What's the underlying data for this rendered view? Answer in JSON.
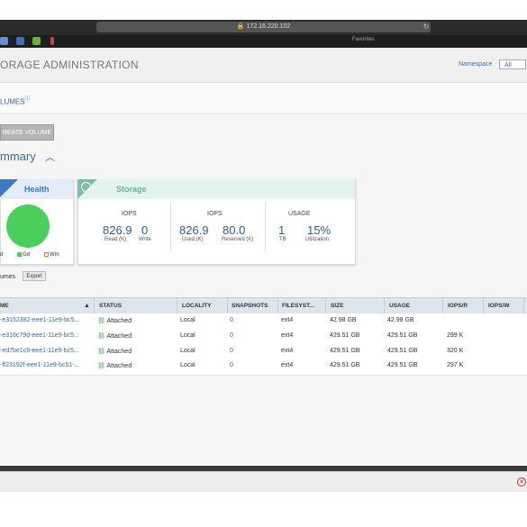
{
  "browser": {
    "url": "172.16.220.102",
    "favorites_label": "Favorites"
  },
  "app": {
    "title": "ORAGE ADMINISTRATION",
    "namespace_label": "Namespace",
    "namespace_value": "All",
    "volumes_tab": "LUMES"
  },
  "actions": {
    "create_volume": "REATE VOLUME",
    "export": "Export"
  },
  "summary": {
    "title": "mmary",
    "health": {
      "title": "Health",
      "legend": [
        "d",
        "Gd",
        "Wm"
      ],
      "colors": {
        "good": "#4bcf5b",
        "warn": "#e07b39"
      }
    },
    "storage": {
      "title": "Storage",
      "sections": [
        {
          "heading": "IOPS",
          "values": [
            {
              "value": "826.9",
              "label": "Read (K)"
            },
            {
              "value": "0",
              "label": "Write"
            }
          ]
        },
        {
          "heading": "IOPS",
          "values": [
            {
              "value": "826.9",
              "label": "Used (K)"
            },
            {
              "value": "80.0",
              "label": "Reserved (K)"
            }
          ]
        },
        {
          "heading": "USAGE",
          "values": [
            {
              "value": "1",
              "label": "TB"
            },
            {
              "value": "15%",
              "label": "Utilization"
            }
          ]
        }
      ]
    }
  },
  "volumes_label": "umes",
  "table": {
    "columns": [
      "ME",
      "STATUS",
      "LOCALITY",
      "SNAPSHOTS",
      "FILESYST...",
      "SIZE",
      "USAGE",
      "IOPS/R",
      "IOPS/W"
    ],
    "rows": [
      [
        "-e3152382-eee1-11e9-bc5...",
        "Attached",
        "Local",
        "0",
        "ext4",
        "42.98 GB",
        "42.98 GB",
        "",
        ""
      ],
      [
        "-e316c79d-eee1-11e9-bc5...",
        "Attached",
        "Local",
        "0",
        "ext4",
        "429.51 GB",
        "429.51 GB",
        "299 K",
        ""
      ],
      [
        "-ed7be1c9-eee1-11e9-bc5...",
        "Attached",
        "Local",
        "0",
        "ext4",
        "429.51 GB",
        "429.51 GB",
        "320 K",
        ""
      ],
      [
        "-ff23192f-eee1-11e9-bc51-...",
        "Attached",
        "Local",
        "0",
        "ext4",
        "429.51 GB",
        "429.51 GB",
        "297 K",
        ""
      ]
    ]
  }
}
